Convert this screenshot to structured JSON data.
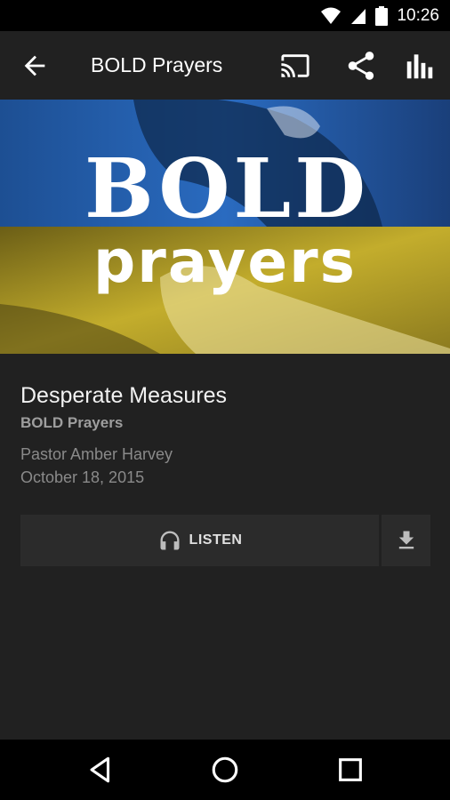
{
  "status_bar": {
    "time": "10:26",
    "icons": [
      "wifi-icon",
      "signal-icon",
      "battery-icon"
    ]
  },
  "app_bar": {
    "title": "BOLD Prayers",
    "icons": [
      "back-arrow-icon",
      "cast-icon",
      "share-icon",
      "stats-icon"
    ]
  },
  "banner": {
    "line1": "BOLD",
    "line2": "prayers",
    "colors": {
      "top": "#1f5fb0",
      "bottom": "#b8a224"
    }
  },
  "episode": {
    "title": "Desperate Measures",
    "series": "BOLD Prayers",
    "speaker": "Pastor Amber Harvey",
    "date": "October 18, 2015"
  },
  "actions": {
    "listen_label": "LISTEN",
    "listen_icon": "headphones-icon",
    "download_icon": "download-icon"
  },
  "nav_bar": {
    "icons": [
      "nav-back-icon",
      "nav-home-icon",
      "nav-recents-icon"
    ]
  }
}
